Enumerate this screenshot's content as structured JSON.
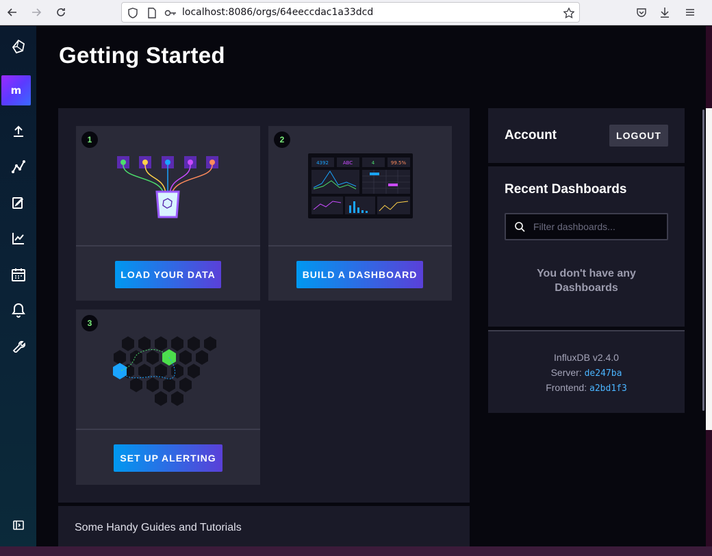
{
  "browser": {
    "url": "localhost:8086/orgs/64eeccdac1a33dcd"
  },
  "sidenav": {
    "org_initial": "m",
    "items": [
      {
        "name": "upload-icon"
      },
      {
        "name": "data-explorer-icon"
      },
      {
        "name": "notebooks-icon"
      },
      {
        "name": "dashboards-icon"
      },
      {
        "name": "tasks-icon"
      },
      {
        "name": "alerts-icon"
      },
      {
        "name": "settings-icon"
      }
    ]
  },
  "page": {
    "title": "Getting Started"
  },
  "cards": [
    {
      "number": "1",
      "button": "LOAD YOUR DATA"
    },
    {
      "number": "2",
      "button": "BUILD A DASHBOARD"
    },
    {
      "number": "3",
      "button": "SET UP ALERTING"
    }
  ],
  "dashboard_preview": {
    "stats": [
      "4392",
      "ABC",
      "4",
      "99.5%"
    ]
  },
  "guides": {
    "title": "Some Handy Guides and Tutorials"
  },
  "account": {
    "heading": "Account",
    "logout_label": "LOGOUT"
  },
  "recent": {
    "heading": "Recent Dashboards",
    "filter_placeholder": "Filter dashboards...",
    "empty_line1": "You don't have any",
    "empty_line2": "Dashboards"
  },
  "version": {
    "product": "InfluxDB v2.4.0",
    "server_label": "Server:",
    "server_value": "de247ba",
    "frontend_label": "Frontend:",
    "frontend_value": "a2bd1f3"
  },
  "colors": {
    "accent_blue": "#0098f0",
    "accent_purple": "#5a40d8",
    "link_blue": "#4ab4ff",
    "step_green": "#7cf07c"
  }
}
